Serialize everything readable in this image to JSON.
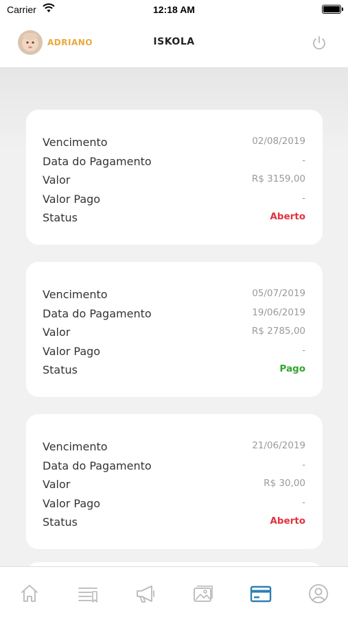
{
  "status_bar": {
    "carrier": "Carrier",
    "time": "12:18 AM"
  },
  "header": {
    "user_name": "ADRIANO",
    "title": "ISKOLA"
  },
  "colors": {
    "accent_user": "#e8a93b",
    "status_open": "#e0323f",
    "status_paid": "#2fa52f",
    "active_tab": "#2d7fb5",
    "inactive_tab": "#b8b8b8"
  },
  "labels": {
    "due": "Vencimento",
    "payment_date": "Data do Pagamento",
    "amount": "Valor",
    "amount_paid": "Valor Pago",
    "status": "Status"
  },
  "invoices": [
    {
      "due": "02/08/2019",
      "payment_date": "-",
      "amount": "R$ 3159,00",
      "amount_paid": "-",
      "status": "Aberto",
      "status_color": "#e0323f"
    },
    {
      "due": "05/07/2019",
      "payment_date": "19/06/2019",
      "amount": "R$ 2785,00",
      "amount_paid": "-",
      "status": "Pago",
      "status_color": "#2fa52f"
    },
    {
      "due": "21/06/2019",
      "payment_date": "-",
      "amount": "R$ 30,00",
      "amount_paid": "-",
      "status": "Aberto",
      "status_color": "#e0323f"
    }
  ],
  "tabs": [
    {
      "icon": "home-icon",
      "active": false
    },
    {
      "icon": "list-icon",
      "active": false
    },
    {
      "icon": "megaphone-icon",
      "active": false
    },
    {
      "icon": "gallery-icon",
      "active": false
    },
    {
      "icon": "credit-card-icon",
      "active": true
    },
    {
      "icon": "profile-icon",
      "active": false
    }
  ]
}
